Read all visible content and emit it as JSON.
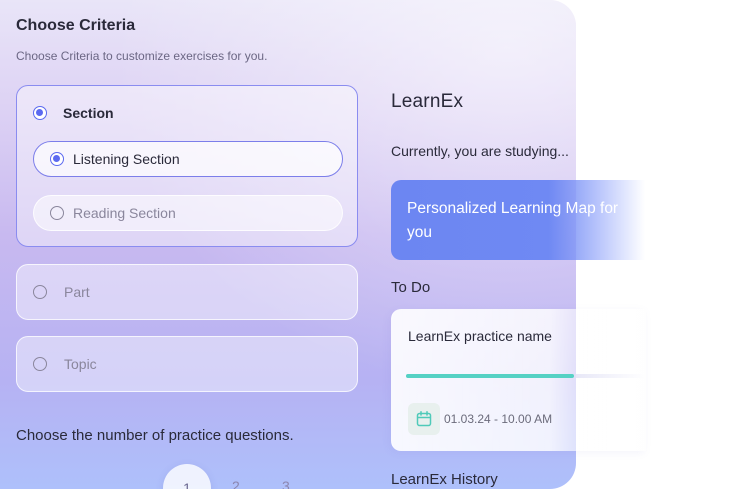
{
  "criteria": {
    "title": "Choose Criteria",
    "subtitle": "Choose Criteria to customize exercises for you.",
    "section": {
      "label": "Section",
      "selected": true,
      "options": [
        {
          "label": "Listening Section",
          "selected": true
        },
        {
          "label": "Reading Section",
          "selected": false
        }
      ]
    },
    "part": {
      "label": "Part",
      "selected": false
    },
    "topic": {
      "label": "Topic",
      "selected": false
    }
  },
  "questions": {
    "heading": "Choose the number of practice questions.",
    "options": [
      "1",
      "2",
      "3"
    ]
  },
  "learnex": {
    "title": "LearnEx",
    "studying_label": "Currently, you are studying...",
    "plan_label": "Personalized Learning Map for you",
    "todo_title": "To Do",
    "todo_item": {
      "name": "LearnEx practice name",
      "progress": 0.7,
      "date": "01.03.24 - 10.00 AM",
      "icon": "calendar-icon"
    },
    "history_title": "LearnEx History"
  },
  "colors": {
    "accent": "#5c6af0",
    "plan_card": "#6c86f2",
    "progress": "#55d1c4",
    "calendar_icon": "#4fcab9"
  }
}
